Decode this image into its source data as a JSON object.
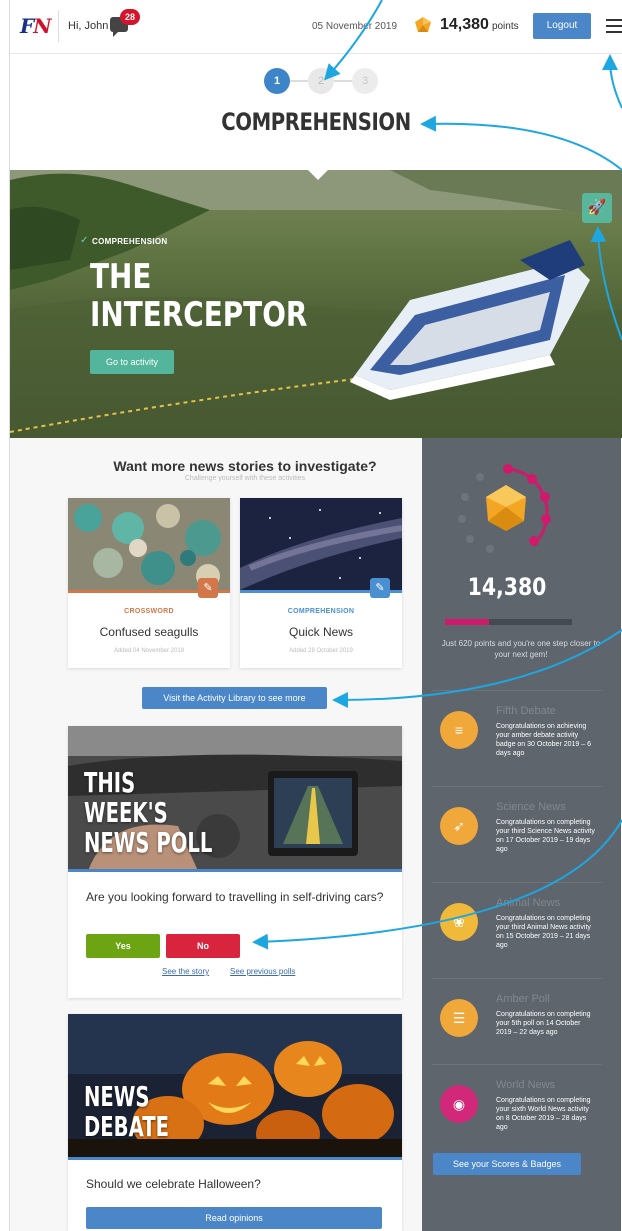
{
  "header": {
    "logo": "FN",
    "greeting": "Hi, John",
    "message_count": "28",
    "date": "05 November 2019",
    "points_value": "14,380",
    "points_unit": "points",
    "logout_label": "Logout"
  },
  "steps": [
    "1",
    "2",
    "3"
  ],
  "page_heading": "COMPREHENSION",
  "hero": {
    "category": "COMPREHENSION",
    "title_line1": "THE",
    "title_line2": "INTERCEPTOR",
    "button_label": "Go to activity"
  },
  "more_section": {
    "title": "Want more news stories to investigate?",
    "subtitle": "Challenge yourself with these activities",
    "cards": [
      {
        "category": "CROSSWORD",
        "title": "Confused seagulls",
        "added": "Added 04 November 2019",
        "color": "#d2774a"
      },
      {
        "category": "COMPREHENSION",
        "title": "Quick News",
        "added": "Added 28 October 2019",
        "color": "#4a90d0"
      }
    ],
    "library_button": "Visit the Activity Library to see more"
  },
  "poll": {
    "title_line1": "THIS",
    "title_line2": "WEEK'S",
    "title_line3": "NEWS POLL",
    "question": "Are you looking forward to travelling in self-driving cars?",
    "yes_label": "Yes",
    "no_label": "No",
    "link_story": "See the story",
    "link_previous": "See previous polls"
  },
  "debate": {
    "title_line1": "NEWS",
    "title_line2": "DEBATE",
    "question": "Should we celebrate Halloween?",
    "button_label": "Read opinions"
  },
  "sidebar": {
    "points": "14,380",
    "progress_fraction": 0.35,
    "note": "Just 620 points and you're one step closer to your next gem!",
    "badges": [
      {
        "name": "Fifth Debate",
        "text": "Congratulations on achieving your amber debate activity badge on 30 October 2019 – 6 days ago",
        "icon": "speech-icon",
        "color": "#f0a83a"
      },
      {
        "name": "Science News",
        "text": "Congratulations on completing your third Science News activity on 17 October 2019 – 19 days ago",
        "icon": "rocket-icon",
        "color": "#f0a83a"
      },
      {
        "name": "Animal News",
        "text": "Congratulations on completing your third Animal News activity on 15 October 2019 – 21 days ago",
        "icon": "paw-icon",
        "color": "#f0b93a"
      },
      {
        "name": "Amber Poll",
        "text": "Congratulations on completing your 5th poll on 14 October 2019 – 22 days ago",
        "icon": "checklist-icon",
        "color": "#f0a83a"
      },
      {
        "name": "World News",
        "text": "Congratulations on completing your sixth World News activity on 8 October 2019 – 28 days ago",
        "icon": "globe-icon",
        "color": "#d1287a"
      }
    ],
    "scores_button": "See your Scores & Badges"
  },
  "colors": {
    "primary_blue": "#4a86c8",
    "sidebar_bg": "#5e656d",
    "accent_magenta": "#cf1a6c",
    "hero_green": "#53b59b",
    "yes_green": "#6da414",
    "no_red": "#d8243c"
  }
}
